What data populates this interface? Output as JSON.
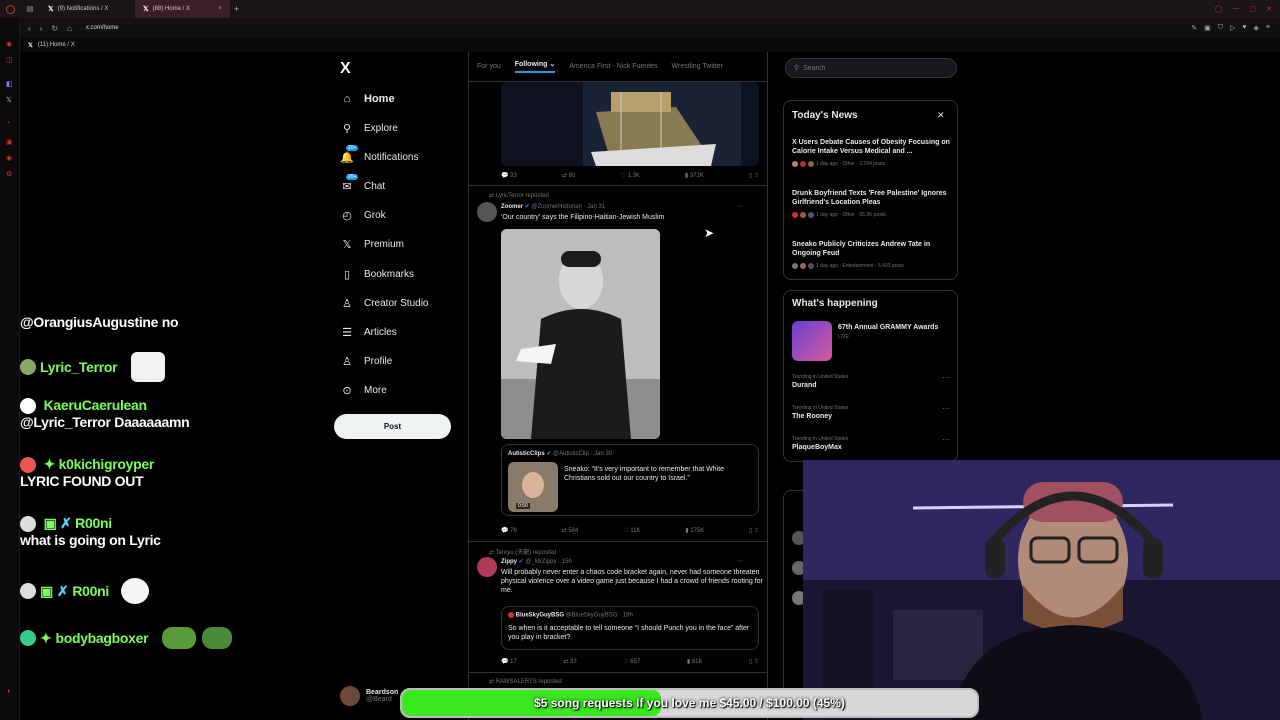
{
  "browser": {
    "tabs": [
      {
        "label": "(9) Notifications / X"
      },
      {
        "label": "(88) Home / X"
      }
    ],
    "url": "x.com/home",
    "subtab": "(11) Home / X"
  },
  "xnav": {
    "logo": "X",
    "items": [
      {
        "label": "Home",
        "icon": "home-icon",
        "glyph": "⌂"
      },
      {
        "label": "Explore",
        "icon": "search-icon",
        "glyph": "⚲"
      },
      {
        "label": "Notifications",
        "icon": "bell-icon",
        "glyph": "🔔",
        "badge": "20+"
      },
      {
        "label": "Chat",
        "icon": "chat-icon",
        "glyph": "✉",
        "badge": "20+"
      },
      {
        "label": "Grok",
        "icon": "grok-icon",
        "glyph": "◴"
      },
      {
        "label": "Premium",
        "icon": "x-premium-icon",
        "glyph": "𝕏"
      },
      {
        "label": "Bookmarks",
        "icon": "bookmark-icon",
        "glyph": "▯"
      },
      {
        "label": "Creator Studio",
        "icon": "creator-icon",
        "glyph": "♙"
      },
      {
        "label": "Articles",
        "icon": "articles-icon",
        "glyph": "☰"
      },
      {
        "label": "Profile",
        "icon": "profile-icon",
        "glyph": "♙"
      },
      {
        "label": "More",
        "icon": "more-icon",
        "glyph": "⊙"
      }
    ],
    "post_label": "Post",
    "account_name": "Beardson",
    "account_handle": "@Beard"
  },
  "timeline": {
    "tabs": [
      "For you",
      "Following",
      "America First - Nick Fuentes",
      "Wrestling Twitter"
    ],
    "active_tab": "Following",
    "tweet0_stats": {
      "replies": "93",
      "reposts": "80",
      "likes": "1.3K",
      "views": "372K"
    },
    "tweet1": {
      "repost_line": "LyricTerror reposted",
      "name": "Zoomer",
      "handle": "@ZoomerHistorian · Jan 31",
      "text": "'Our country' says the Filipino-Haitian-Jewish Muslim",
      "quote_name": "AutisticClips",
      "quote_handle": "@AutisticClip · Jan 30",
      "quote_text": "Sneako: “It's very important to remember that White Christians sold out our country to Israel.”",
      "quote_duration": "0:50",
      "stats": {
        "replies": "76",
        "reposts": "584",
        "likes": "11K",
        "views": "175K"
      }
    },
    "tweet2": {
      "repost_line": "Tenryu (天龍) reposted",
      "name": "Zippy",
      "handle": "@_MrZippy · 15h",
      "text": "Will probably never enter a chaos code bracket again, never had someone threaten physical violence over a video game just because I had a crowd of friends rooting for me.",
      "quote_name": "BlueSkyGuyBSG",
      "quote_handle": "@BlueSkyGuyBSG · 19h",
      "quote_text": "So when is it acceptable to tell someone “I should Punch you in the face” after you play in bracket?",
      "stats": {
        "replies": "17",
        "reposts": "33",
        "likes": "657",
        "views": "81K"
      }
    },
    "tweet3_repost": "RAWSALERTS reposted"
  },
  "right": {
    "search_placeholder": "Search",
    "news_title": "Today's News",
    "news": [
      {
        "title": "X Users Debate Causes of Obesity Focusing on Calorie Intake Versus Medical and ...",
        "meta": "1 day ago · Other · 2,294 posts"
      },
      {
        "title": "Drunk Boyfriend Texts 'Free Palestine' Ignores Girlfriend's Location Pleas",
        "meta": "1 day ago · Other · 55.3K posts"
      },
      {
        "title": "Sneako Publicly Criticizes Andrew Tate in Ongoing Feud",
        "meta": "1 day ago · Entertainment · 5,433 posts"
      }
    ],
    "happening_title": "What's happening",
    "event_title": "67th Annual GRAMMY Awards",
    "event_status": "LIVE",
    "trends": [
      {
        "sub": "Trending in United States",
        "name": "Durand"
      },
      {
        "sub": "Trending in United States",
        "name": "The Rooney"
      },
      {
        "sub": "Trending in United States",
        "name": "PlaqueBoyMax"
      }
    ]
  },
  "chat": [
    {
      "user": "",
      "message": "@OrangiusAugustine no"
    },
    {
      "user": "Lyric_Terror",
      "message": ""
    },
    {
      "user": "KaeruCaerulean",
      "message": "@Lyric_Terror Daaaaaamn"
    },
    {
      "user": "k0kichigroyper",
      "message": "LYRIC FOUND OUT"
    },
    {
      "user": "R00ni",
      "message": "what is going on Lyric"
    },
    {
      "user": "R00ni",
      "message": ""
    },
    {
      "user": "bodybagboxer",
      "message": ""
    }
  ],
  "donation": {
    "text": "$5 song requests If you love me $45.00 / $100.00 (45%)",
    "progress": 0.45
  },
  "colors": {
    "accent": "#1d9bf0",
    "donation_fill": "#39e81e",
    "chat_name": "#7cfc5a"
  }
}
